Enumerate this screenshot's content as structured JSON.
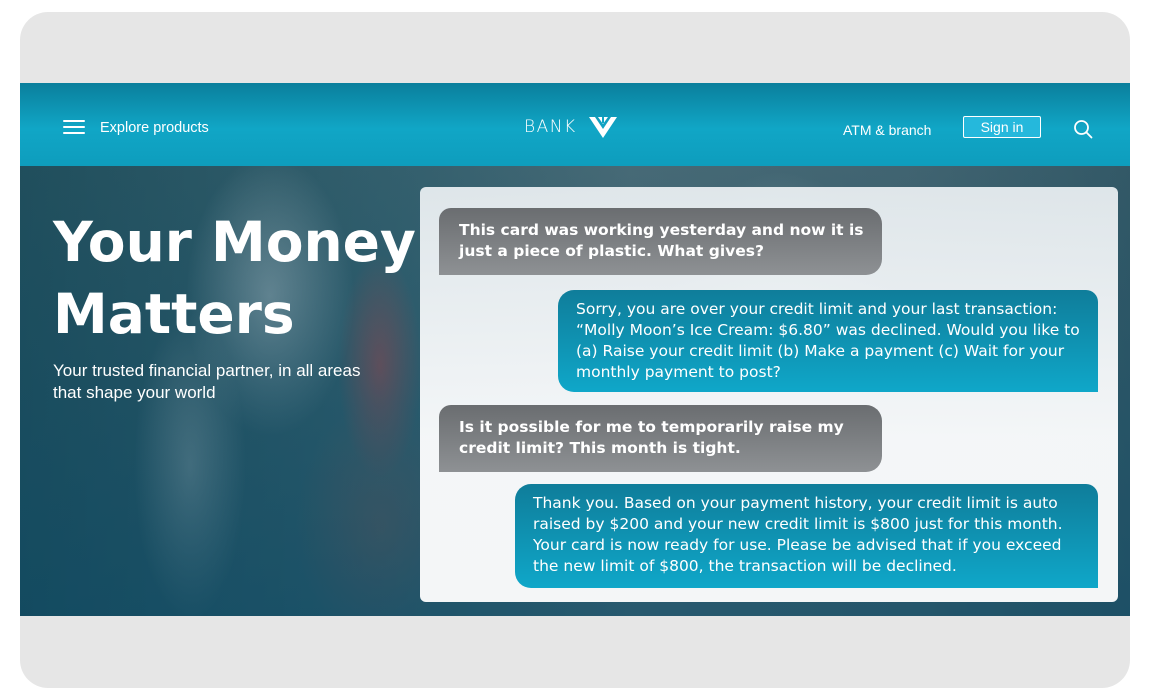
{
  "nav": {
    "menu_icon": "hamburger-menu-icon",
    "explore_label": "Explore products",
    "brand_text": "BANK",
    "brand_icon": "bank-logo-icon",
    "atm_label": "ATM & branch",
    "signin_label": "Sign in",
    "search_icon": "search-icon"
  },
  "hero": {
    "headline": "Your Money Matters",
    "subline": "Your trusted financial partner, in all areas that shape your world"
  },
  "chat": {
    "messages": [
      {
        "sender": "user",
        "text": "This card was working yesterday and now it is just a piece of plastic. What gives?"
      },
      {
        "sender": "bot",
        "text": "Sorry, you are over your credit limit and your last transaction: “Molly Moon’s Ice Cream: $6.80” was declined. Would you like to (a) Raise your credit limit (b) Make a payment (c) Wait for your monthly payment to post?"
      },
      {
        "sender": "user",
        "text": "Is it possible for me to temporarily raise my credit limit? This month is tight."
      },
      {
        "sender": "bot",
        "text": "Thank you. Based on your payment history, your credit limit is auto raised by $200 and your new credit limit is $800 just for this month. Your card is now ready for use. Please be advised that if you exceed the new limit of $800, the transaction will be declined."
      }
    ]
  },
  "colors": {
    "nav_teal": "#10a6c6",
    "bot_bubble": "#0fa7c9",
    "user_bubble": "#7a7d80",
    "signin_fill": "#25b8dc"
  }
}
